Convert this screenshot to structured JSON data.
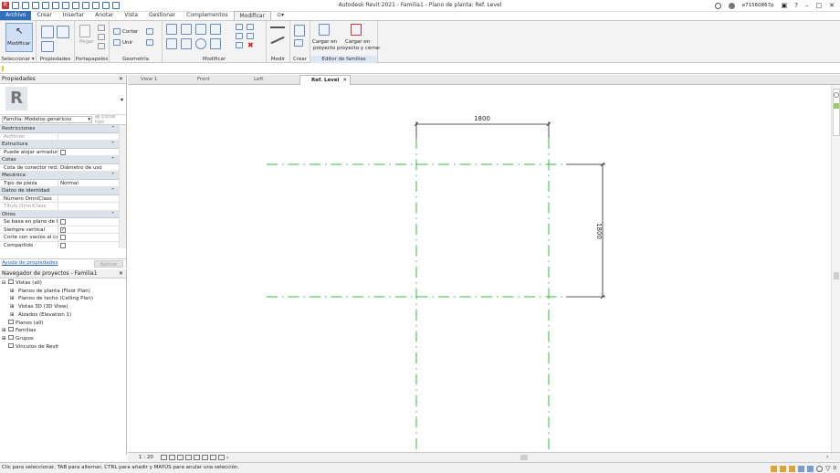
{
  "window": {
    "title": "Autodesk Revit 2021 - Familia1 - Plano de planta: Ref. Level",
    "user": "e71560867p",
    "help": "?"
  },
  "menu": {
    "tabs": [
      "Archivo",
      "Crear",
      "Insertar",
      "Anotar",
      "Vista",
      "Gestionar",
      "Complementos",
      "Modificar"
    ]
  },
  "ribbon": {
    "modificar_label": "Modificar",
    "cortar": "Cortar",
    "unir": "Unir",
    "pegar": "Pegar",
    "cargar_proyecto_1": "Cargar en",
    "cargar_proyecto_2": "proyecto",
    "cargar_cerrar_1": "Cargar en",
    "cargar_cerrar_2": "proyecto y cerrar",
    "groups": {
      "seleccionar": "Seleccionar",
      "propiedades": "Propiedades",
      "portapapeles": "Portapapeles",
      "geometria": "Geometría",
      "modificar": "Modificar",
      "medir": "Medir",
      "crear": "Crear",
      "editor": "Editor de familias"
    }
  },
  "properties": {
    "title": "Propiedades",
    "family_type": "Familia: Modelos genéricos",
    "edit_type": "Editar tipo",
    "categories": [
      {
        "name": "Restricciones",
        "rows": [
          {
            "k": "Anfitrión",
            "v": "",
            "gray": true
          }
        ]
      },
      {
        "name": "Estructura",
        "rows": [
          {
            "k": "Puede alojar armadura",
            "v": "",
            "check": false
          }
        ]
      },
      {
        "name": "Cotas",
        "rows": [
          {
            "k": "Cota de conector red...",
            "v": "Diámetro de uso"
          }
        ]
      },
      {
        "name": "Mecánica",
        "rows": [
          {
            "k": "Tipo de pieza",
            "v": "Normal"
          }
        ]
      },
      {
        "name": "Datos de identidad",
        "rows": [
          {
            "k": "Número OmniClass",
            "v": ""
          },
          {
            "k": "Título OmniClass",
            "v": "",
            "gray": true
          }
        ]
      },
      {
        "name": "Otros",
        "rows": [
          {
            "k": "Se basa en plano de tr...",
            "v": "",
            "check": false
          },
          {
            "k": "Siempre vertical",
            "v": "",
            "check": true
          },
          {
            "k": "Corte con vacíos al ca...",
            "v": "",
            "check": false
          },
          {
            "k": "Compartido",
            "v": "",
            "check": false
          },
          {
            "k": "Punto de cálculo de h...",
            "v": "",
            "check": false
          }
        ]
      }
    ],
    "help_link": "Ayuda de propiedades",
    "apply": "Aplicar"
  },
  "browser": {
    "title": "Navegador de proyectos - Familia1",
    "items": [
      {
        "label": "Vistas (all)",
        "level": 0,
        "toggle": "−"
      },
      {
        "label": "Planos de planta (Floor Plan)",
        "level": 1,
        "toggle": "+"
      },
      {
        "label": "Planos de techo (Ceiling Plan)",
        "level": 1,
        "toggle": "+"
      },
      {
        "label": "Vistas 3D (3D View)",
        "level": 1,
        "toggle": "+"
      },
      {
        "label": "Alzados (Elevation 1)",
        "level": 1,
        "toggle": "+"
      },
      {
        "label": "Planos (all)",
        "level": 0,
        "toggle": ""
      },
      {
        "label": "Familias",
        "level": 0,
        "toggle": "+"
      },
      {
        "label": "Grupos",
        "level": 0,
        "toggle": "+"
      },
      {
        "label": "Vínculos de Revit",
        "level": 0,
        "toggle": ""
      }
    ]
  },
  "view_tabs": [
    {
      "label": "View 1",
      "active": false
    },
    {
      "label": "Front",
      "active": false
    },
    {
      "label": "Left",
      "active": false
    },
    {
      "label": "Ref. Level",
      "active": true
    }
  ],
  "drawing": {
    "dim_horizontal": "1800",
    "dim_vertical": "1800",
    "ref_color": "#3cb44b"
  },
  "view_control": {
    "scale": "1 : 20"
  },
  "status": {
    "text": "Clic para seleccionar, TAB para alternar, CTRL para añadir y MAYÚS para anular una selección.",
    "filter_count": "0"
  }
}
